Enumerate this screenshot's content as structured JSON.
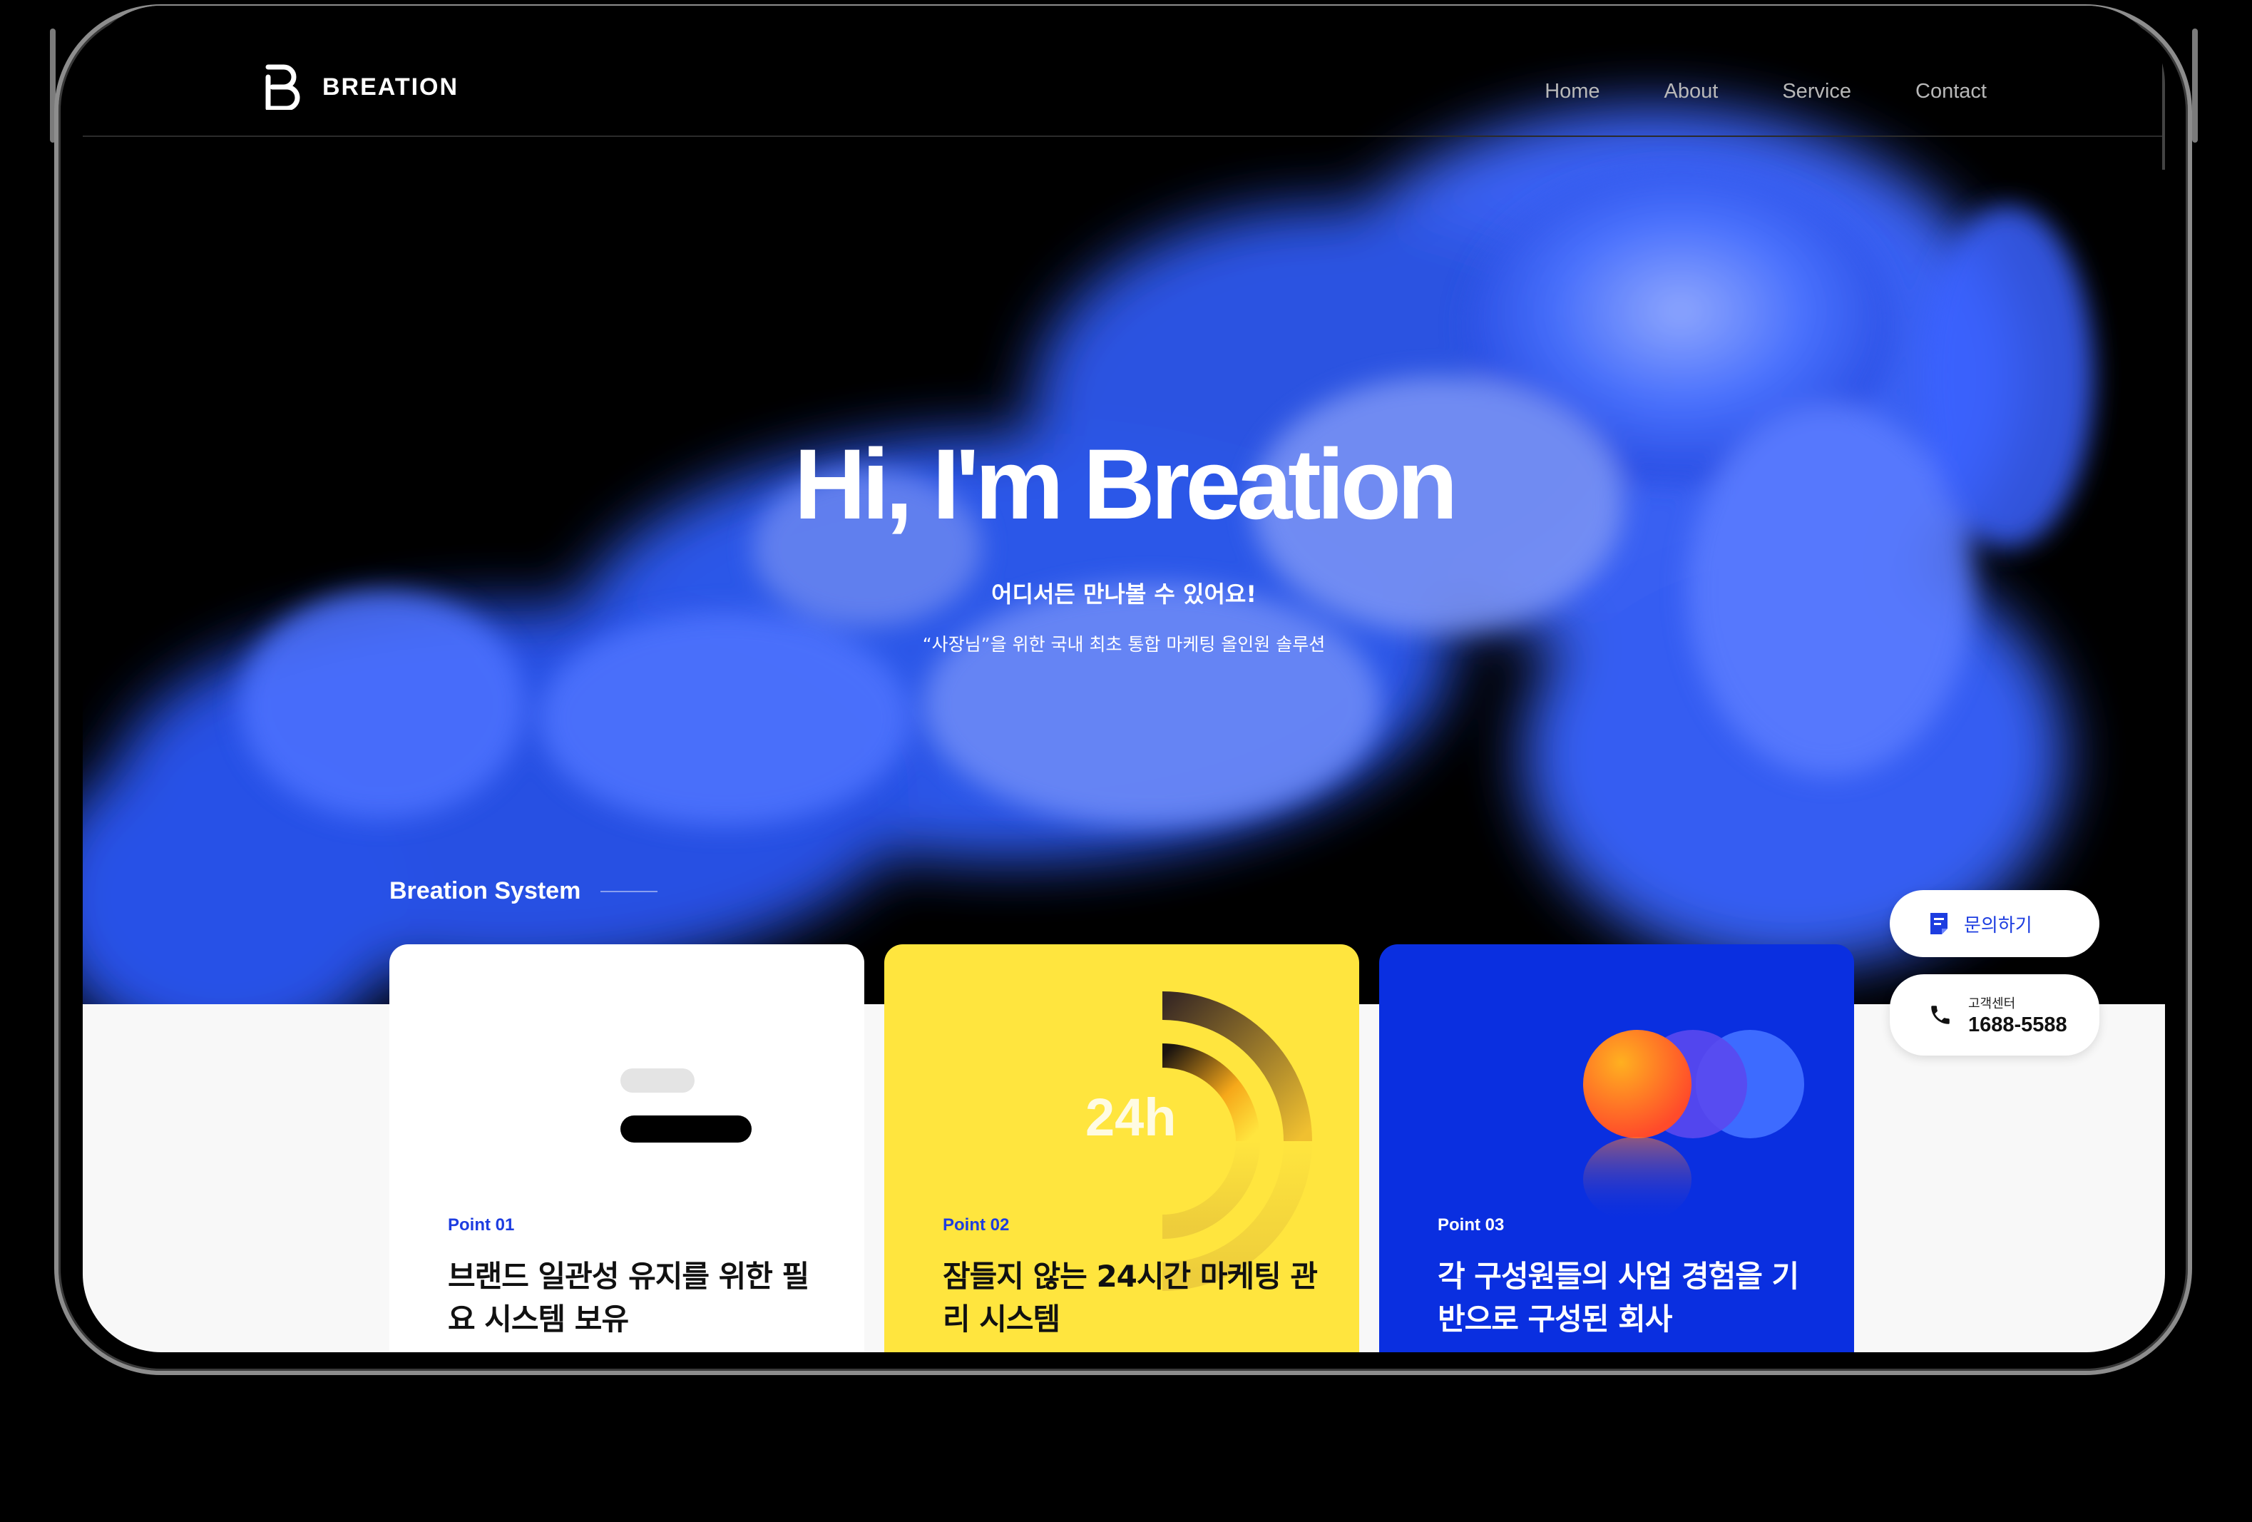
{
  "brand": {
    "name": "BREATION"
  },
  "nav": [
    {
      "label": "Home"
    },
    {
      "label": "About"
    },
    {
      "label": "Service"
    },
    {
      "label": "Contact"
    }
  ],
  "hero": {
    "title": "Hi, I'm Breation",
    "subtitle": "어디서든 만나볼 수 있어요!",
    "description": "“사장님”을 위한 국내 최초 통합 마케팅 올인원 솔루션"
  },
  "system": {
    "title": "Breation System",
    "cards": [
      {
        "point": "Point 01",
        "text": "브랜드 일관성 유지를 위한 필요 시스템 보유"
      },
      {
        "point": "Point 02",
        "text": "잠들지 않는 24시간 마케팅 관리 시스템",
        "graphic_label": "24h"
      },
      {
        "point": "Point 03",
        "text": "각 구성원들의 사업 경험을 기반으로 구성된 회사"
      }
    ]
  },
  "floating": {
    "inquiry_label": "문의하기",
    "support_label": "고객센터",
    "support_number": "1688-5588"
  },
  "colors": {
    "accent_blue": "#1d3de0",
    "card_yellow": "#ffe53e",
    "card_blue": "#0a2fe0",
    "smoke_blue": "#3a66ff"
  },
  "icons": {
    "inquiry": "document-icon",
    "support": "phone-icon"
  }
}
